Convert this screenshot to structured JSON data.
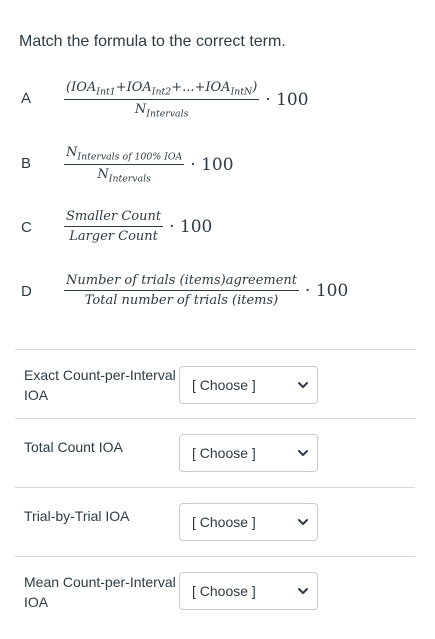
{
  "question": {
    "instructions": "Match the formula to the correct term."
  },
  "answers": [
    {
      "letter": "A",
      "numerator": "(IOA",
      "numerator_parts": [
        "(IOA",
        "Int1",
        "+IOA",
        "Int2",
        "+...+IOA",
        "IntN",
        ")"
      ],
      "denominator_parts": [
        "N",
        "Intervals"
      ],
      "multiplier": "· 100"
    },
    {
      "letter": "B",
      "numerator_parts": [
        "N",
        "Intervals of 100% IOA"
      ],
      "denominator_parts": [
        "N",
        "Intervals"
      ],
      "multiplier": "· 100"
    },
    {
      "letter": "C",
      "numerator_text": "Smaller Count",
      "denominator_text": "Larger Count",
      "multiplier": "· 100"
    },
    {
      "letter": "D",
      "numerator_text": "Number of trials (items)agreement",
      "denominator_text": "Total number of trials (items)",
      "multiplier": "· 100"
    }
  ],
  "matches": [
    {
      "term": "Exact Count-per-Interval IOA",
      "selected": "[ Choose ]"
    },
    {
      "term": "Total Count IOA",
      "selected": "[ Choose ]"
    },
    {
      "term": "Trial-by-Trial IOA",
      "selected": "[ Choose ]"
    },
    {
      "term": "Mean Count-per-Interval IOA",
      "selected": "[ Choose ]"
    }
  ],
  "colors": {
    "text": "#2d3b45",
    "divider": "#d7dadd",
    "select_border": "#c7cdd1"
  },
  "icons": {
    "select_arrow": "chevron-down-icon"
  }
}
